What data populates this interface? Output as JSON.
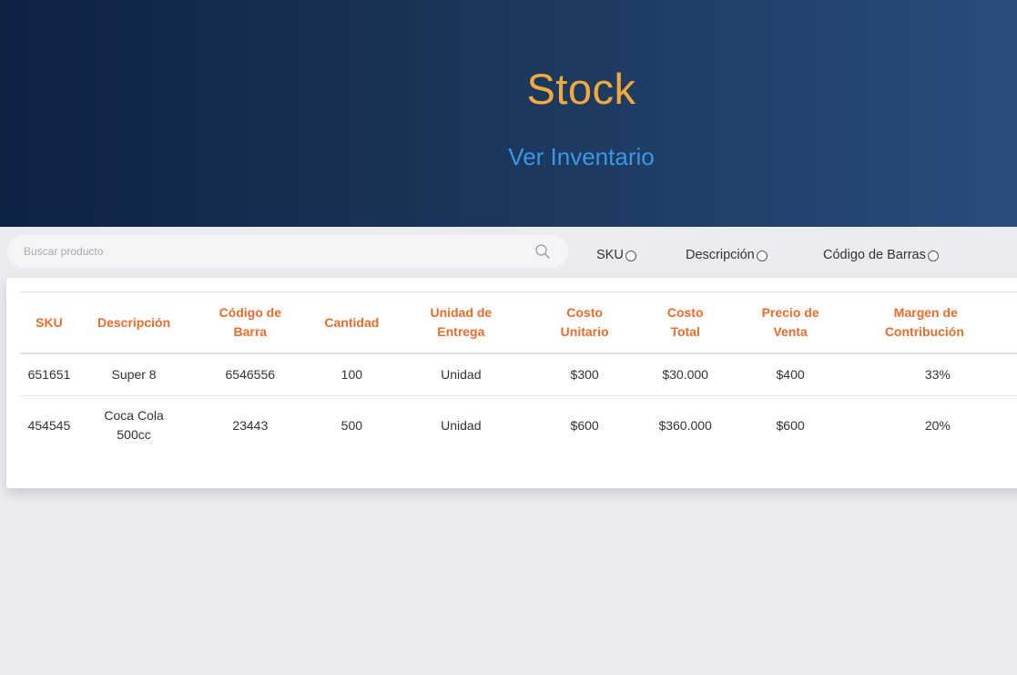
{
  "header": {
    "title": "Stock",
    "subtitle": "Ver Inventario"
  },
  "search": {
    "placeholder": "Buscar producto",
    "value": "",
    "icon": "search-icon"
  },
  "filters": [
    {
      "label": "SKU",
      "checked": false
    },
    {
      "label": "Descripción",
      "checked": false
    },
    {
      "label": "Código de Barras",
      "checked": false
    }
  ],
  "table": {
    "columns": [
      {
        "line1": "SKU",
        "line2": ""
      },
      {
        "line1": "Descripción",
        "line2": ""
      },
      {
        "line1": "Código de",
        "line2": "Barra"
      },
      {
        "line1": "Cantidad",
        "line2": ""
      },
      {
        "line1": "Unidad de",
        "line2": "Entrega"
      },
      {
        "line1": "Costo",
        "line2": "Unitario"
      },
      {
        "line1": "Costo",
        "line2": "Total"
      },
      {
        "line1": "Precio de",
        "line2": "Venta"
      },
      {
        "line1": "Margen de",
        "line2": "Contribución"
      }
    ],
    "rows": [
      {
        "sku": "651651",
        "descripcion": [
          "Super 8"
        ],
        "codigo_barra": "6546556",
        "cantidad": "100",
        "unidad": "Unidad",
        "costo_unitario": "$300",
        "costo_total": "$30.000",
        "precio_venta": "$400",
        "margen": "33%"
      },
      {
        "sku": "454545",
        "descripcion": [
          "Coca Cola",
          "500cc"
        ],
        "codigo_barra": "23443",
        "cantidad": "500",
        "unidad": "Unidad",
        "costo_unitario": "$600",
        "costo_total": "$360.000",
        "precio_venta": "$600",
        "margen": "20%"
      }
    ]
  },
  "colors": {
    "title": "#f2a93b",
    "subtitle": "#3b97e8",
    "table_header": "#ea6c2d",
    "header_bg_dark": "#0e2244",
    "header_bg_light": "#284d7c"
  }
}
